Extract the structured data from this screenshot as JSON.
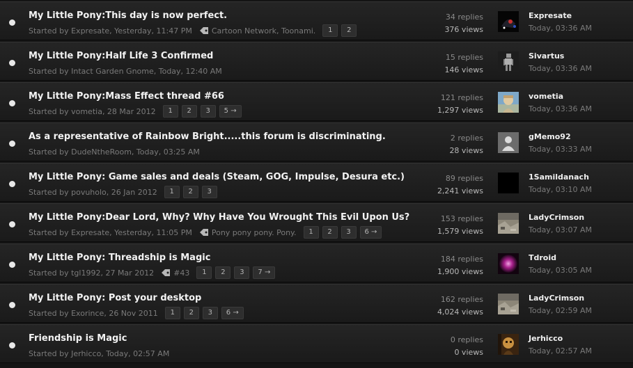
{
  "topics": [
    {
      "title": "My Little Pony:This day is now perfect.",
      "started": "Started by Expresate, Yesterday, 11:47 PM",
      "tag": "Cartoon Network, Toonami.",
      "pages": [
        "1",
        "2"
      ],
      "replies": "34 replies",
      "views": "376 views",
      "last_user": "Expresate",
      "last_time": "Today, 03:36 AM",
      "avatar_icon": "dark-creature-avatar"
    },
    {
      "title": "My Little Pony:Half Life 3 Confirmed",
      "started": "Started by Intact Garden Gnome, Today, 12:40 AM",
      "tag": "",
      "pages": [],
      "replies": "15 replies",
      "views": "146 views",
      "last_user": "Sivartus",
      "last_time": "Today, 03:36 AM",
      "avatar_icon": "robot-figure-avatar"
    },
    {
      "title": "My Little Pony:Mass Effect thread #66",
      "started": "Started by vometia, 28 Mar 2012",
      "tag": "",
      "pages": [
        "1",
        "2",
        "3",
        "5 →"
      ],
      "replies": "121 replies",
      "views": "1,297 views",
      "last_user": "vometia",
      "last_time": "Today, 03:36 AM",
      "avatar_icon": "photo-person-avatar"
    },
    {
      "title": "As a representative of Rainbow Bright.....this forum is discriminating.",
      "started": "Started by DudeNtheRoom, Today, 03:25 AM",
      "tag": "",
      "pages": [],
      "replies": "2 replies",
      "views": "28 views",
      "last_user": "gMemo92",
      "last_time": "Today, 03:33 AM",
      "avatar_icon": "default-user-avatar"
    },
    {
      "title": "My Little Pony: Game sales and deals (Steam, GOG, Impulse, Desura etc.)",
      "started": "Started by povuholo, 26 Jan 2012",
      "tag": "",
      "pages": [
        "1",
        "2",
        "3"
      ],
      "replies": "89 replies",
      "views": "2,241 views",
      "last_user": "1Samildanach",
      "last_time": "Today, 03:10 AM",
      "avatar_icon": "black-avatar"
    },
    {
      "title": "My Little Pony:Dear Lord, Why? Why Have You Wrought This Evil Upon Us?",
      "started": "Started by Expresate, Yesterday, 11:05 PM",
      "tag": "Pony pony pony. Pony.",
      "pages": [
        "1",
        "2",
        "3",
        "6 →"
      ],
      "replies": "153 replies",
      "views": "1,579 views",
      "last_user": "LadyCrimson",
      "last_time": "Today, 03:07 AM",
      "avatar_icon": "rubble-photo-avatar"
    },
    {
      "title": "My Little Pony: Threadship is Magic",
      "started": "Started by tgl1992, 27 Mar 2012",
      "tag": "#43",
      "pages": [
        "1",
        "2",
        "3",
        "7 →"
      ],
      "replies": "184 replies",
      "views": "1,900 views",
      "last_user": "Tdroid",
      "last_time": "Today, 03:05 AM",
      "avatar_icon": "glowing-orb-avatar"
    },
    {
      "title": "My Little Pony: Post your desktop",
      "started": "Started by Exorince, 26 Nov 2011",
      "tag": "",
      "pages": [
        "1",
        "2",
        "3",
        "6 →"
      ],
      "replies": "162 replies",
      "views": "4,024 views",
      "last_user": "LadyCrimson",
      "last_time": "Today, 02:59 AM",
      "avatar_icon": "rubble-photo-avatar"
    },
    {
      "title": "Friendship is Magic",
      "started": "Started by Jerhicco, Today, 02:57 AM",
      "tag": "",
      "pages": [],
      "replies": "0 replies",
      "views": "0 views",
      "last_user": "Jerhicco",
      "last_time": "Today, 02:57 AM",
      "avatar_icon": "gold-portrait-avatar"
    }
  ]
}
